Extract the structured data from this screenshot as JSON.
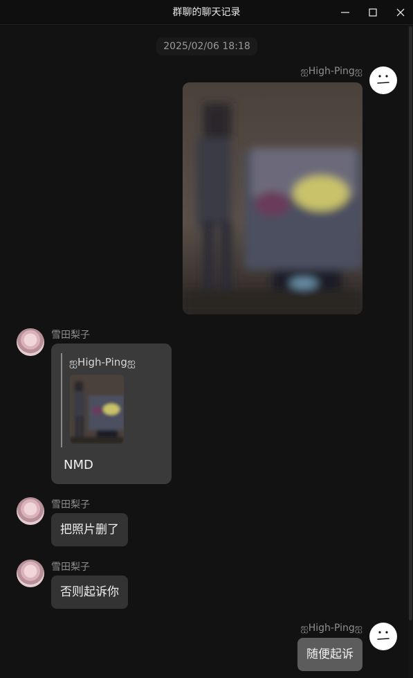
{
  "window": {
    "title": "群聊的聊天记录",
    "controls": {
      "minimize": "minimize-icon",
      "maximize": "maximize-icon",
      "close": "close-icon"
    }
  },
  "timestamp": "2025/02/06 18:18",
  "messages": [
    {
      "sender": "ஐHigh-Pingஐ",
      "side": "right",
      "type": "image"
    },
    {
      "sender": "雪田梨子",
      "side": "left",
      "type": "quote",
      "quote_sender": "ஐHigh-Pingஐ",
      "quote_type": "image",
      "text": "NMD"
    },
    {
      "sender": "雪田梨子",
      "side": "left",
      "type": "text",
      "text": "把照片删了"
    },
    {
      "sender": "雪田梨子",
      "side": "left",
      "type": "text",
      "text": "否则起诉你"
    },
    {
      "sender": "ஐHigh-Pingஐ",
      "side": "right",
      "type": "text",
      "text": "随便起诉"
    }
  ],
  "colors": {
    "background": "#121212",
    "titlebar": "#0f0f0f",
    "bubble_other": "#333333",
    "bubble_self": "#5c5c5c",
    "name_text": "#8f8f8f"
  }
}
